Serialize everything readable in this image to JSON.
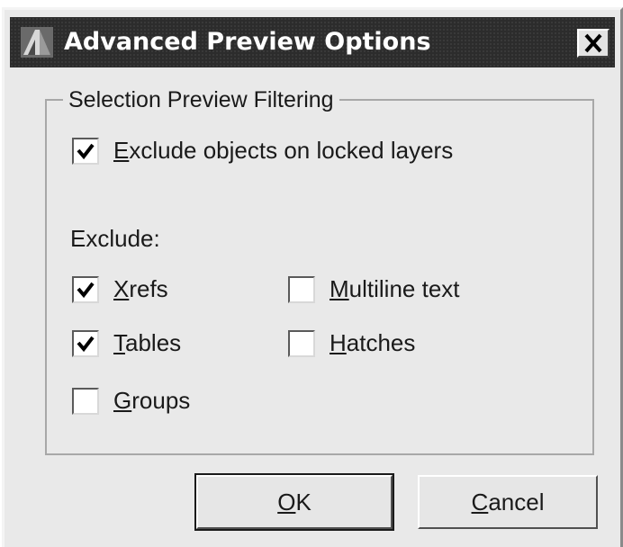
{
  "window": {
    "title": "Advanced Preview Options",
    "app_icon": "autocad-icon",
    "close_icon": "close-icon"
  },
  "group": {
    "title": "Selection Preview Filtering",
    "exclude_locked": {
      "label_hotkey": "E",
      "label_rest": "xclude objects on locked layers",
      "checked": true
    },
    "exclude_heading": "Exclude:",
    "options": [
      {
        "hotkey": "X",
        "rest": "refs",
        "checked": true
      },
      {
        "hotkey": "T",
        "rest": "ables",
        "checked": true
      },
      {
        "hotkey": "G",
        "rest": "roups",
        "checked": false
      },
      {
        "hotkey": "M",
        "rest": "ultiline text",
        "checked": false
      },
      {
        "hotkey": "H",
        "rest": "atches",
        "checked": false
      }
    ]
  },
  "buttons": {
    "ok": {
      "hotkey": "O",
      "rest": "K"
    },
    "cancel": {
      "hotkey": "C",
      "rest": "ancel"
    }
  },
  "colors": {
    "titlebar": "#2c2c2c",
    "dialog_bg": "#e9e9e9"
  }
}
